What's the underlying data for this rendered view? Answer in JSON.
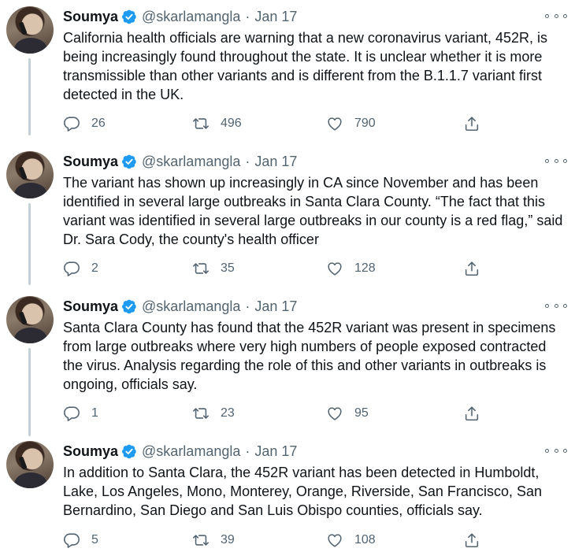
{
  "tweets": [
    {
      "name": "Soumya",
      "handle": "@skarlamangla",
      "separator": "·",
      "date": "Jan 17",
      "text": "California health officials are warning that a new coronavirus variant, 452R, is being increasingly found throughout the state. It is unclear whether it is more transmissible than other variants and is different from the B.1.1.7 variant first detected in the UK.",
      "replies": "26",
      "retweets": "496",
      "likes": "790"
    },
    {
      "name": "Soumya",
      "handle": "@skarlamangla",
      "separator": "·",
      "date": "Jan 17",
      "text": "The variant has shown up increasingly in CA since November and has been identified in several large outbreaks in Santa Clara County. “The fact that this variant was identified in several large outbreaks in our county is a red flag,” said Dr. Sara Cody, the county's health officer",
      "replies": "2",
      "retweets": "35",
      "likes": "128"
    },
    {
      "name": "Soumya",
      "handle": "@skarlamangla",
      "separator": "·",
      "date": "Jan 17",
      "text": "Santa Clara County has found that the 452R variant was present in specimens from large outbreaks where very high numbers of people exposed contracted the virus. Analysis regarding the role of this and other variants in outbreaks is ongoing, officials say.",
      "replies": "1",
      "retweets": "23",
      "likes": "95"
    },
    {
      "name": "Soumya",
      "handle": "@skarlamangla",
      "separator": "·",
      "date": "Jan 17",
      "text": "In addition to Santa Clara, the 452R variant has been detected in Humboldt, Lake, Los Angeles, Mono, Monterey, Orange, Riverside, San Francisco, San Bernardino, San Diego and San Luis Obispo counties, officials say.",
      "replies": "5",
      "retweets": "39",
      "likes": "108"
    }
  ],
  "colors": {
    "text": "#0f1419",
    "secondary": "#536471",
    "verified": "#1d9bf0",
    "thread_line": "#c4cfd6"
  },
  "icons": {
    "verified": "verified-badge-icon",
    "more": "more-options-icon",
    "reply": "reply-icon",
    "retweet": "retweet-icon",
    "like": "like-icon",
    "share": "share-icon"
  }
}
